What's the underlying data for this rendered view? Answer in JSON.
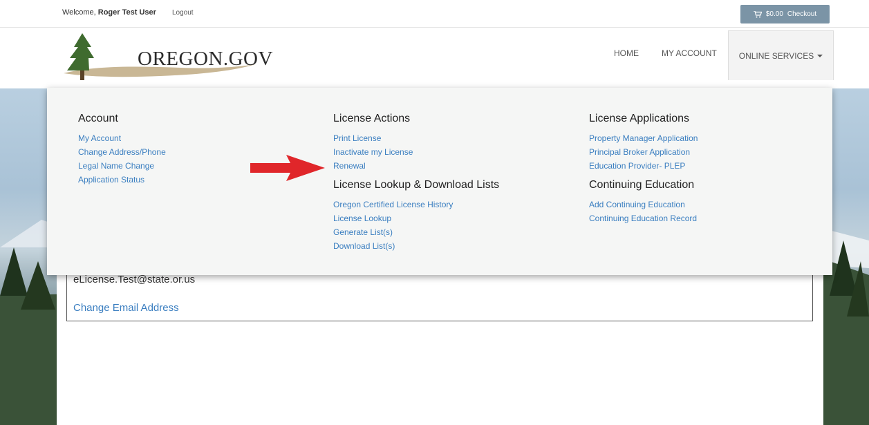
{
  "topbar": {
    "welcome_prefix": "Welcome,",
    "user_name": "Roger Test User",
    "logout": "Logout",
    "cart_amount": "$0.00",
    "checkout": "Checkout"
  },
  "header": {
    "logo_text": "OREGON.GOV",
    "nav": {
      "home": "HOME",
      "my_account": "MY ACCOUNT",
      "online_services": "ONLINE SERVICES"
    }
  },
  "dropdown": {
    "account": {
      "title": "Account",
      "links": [
        "My Account",
        "Change Address/Phone",
        "Legal Name Change",
        "Application Status"
      ]
    },
    "license_actions": {
      "title": "License Actions",
      "links": [
        "Print License",
        "Inactivate my License",
        "Renewal"
      ]
    },
    "license_lookup": {
      "title": "License Lookup & Download Lists",
      "links": [
        "Oregon Certified License History",
        "License Lookup",
        "Generate List(s)",
        "Download List(s)"
      ]
    },
    "license_applications": {
      "title": "License Applications",
      "links": [
        "Property Manager Application",
        "Principal Broker Application",
        "Education Provider- PLEP"
      ]
    },
    "continuing_education": {
      "title": "Continuing Education",
      "links": [
        "Add Continuing Education",
        "Continuing Education Record"
      ]
    }
  },
  "content": {
    "email": "eLicense.Test@state.or.us",
    "change_email": "Change Email Address"
  },
  "colors": {
    "link": "#3a7ec0",
    "checkout_bg": "#7b94a6",
    "arrow": "#e0262a"
  }
}
